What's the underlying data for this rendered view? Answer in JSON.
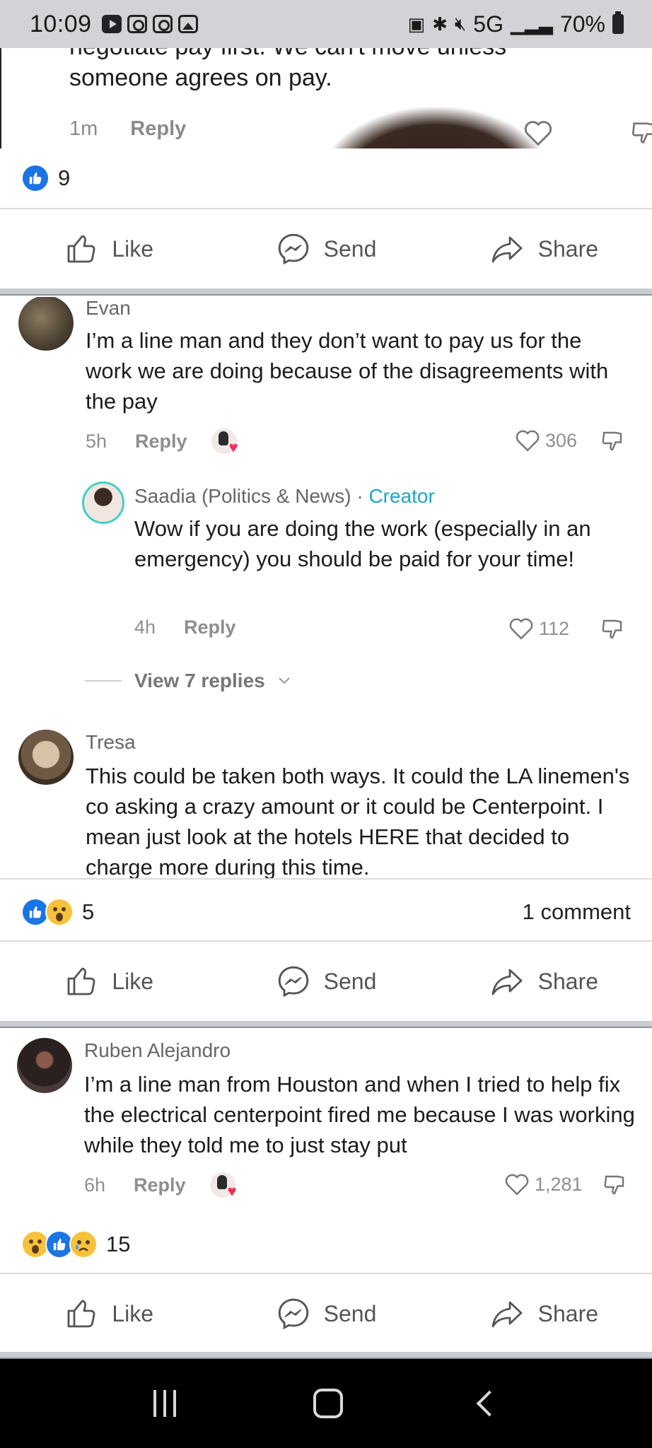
{
  "status_bar": {
    "time": "10:09",
    "network": "5G",
    "battery": "70%",
    "app_icons": [
      "youtube-icon",
      "instagram-icon",
      "instagram-icon",
      "gallery-icon"
    ]
  },
  "top_comment": {
    "text_cut": "negotiate pay first. We can't move unless",
    "text": "someone agrees on pay.",
    "time": "1m",
    "reply_label": "Reply"
  },
  "post1": {
    "reaction_count": "9",
    "reactions": [
      "like"
    ]
  },
  "actions": {
    "like": "Like",
    "send": "Send",
    "share": "Share"
  },
  "comment_evan": {
    "name": "Evan",
    "text": "I’m a line man and they don’t want to pay us for the work we are doing because of the disagreements with the pay",
    "time": "5h",
    "reply_label": "Reply",
    "likes": "306"
  },
  "reply_saadia": {
    "name": "Saadia (Politics & News)",
    "separator": " · ",
    "badge": "Creator",
    "text": "Wow if you are doing the work (especially in an emergency) you should be paid for your time!",
    "time": "4h",
    "reply_label": "Reply",
    "likes": "112",
    "view_replies": "View 7 replies"
  },
  "comment_tresa": {
    "name": "Tresa",
    "text": "This could be taken both ways. It could the LA linemen's co asking a crazy amount or it could be Centerpoint. I mean just look at the hotels HERE that decided to charge more during this time."
  },
  "post2": {
    "reaction_count": "5",
    "reactions": [
      "like",
      "wow"
    ],
    "comments": "1 comment"
  },
  "comment_ruben": {
    "name": "Ruben Alejandro",
    "text": "I’m a line man from Houston and when I tried to help fix the electrical centerpoint fired me because I was working while they told me to just stay put",
    "time": "6h",
    "reply_label": "Reply",
    "likes": "1,281"
  },
  "post3": {
    "reaction_count": "15",
    "reactions": [
      "wow",
      "like",
      "sad"
    ]
  },
  "colors": {
    "facebook_blue": "#1b74e4",
    "creator_teal": "#20a4c8",
    "tiktok_red": "#fe2c55"
  }
}
